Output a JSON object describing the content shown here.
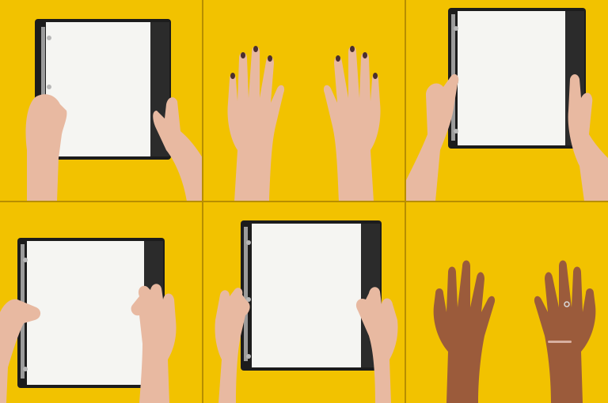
{
  "panels": [
    {
      "id": "p1",
      "content": "binder",
      "hands": "light"
    },
    {
      "id": "p2",
      "content": "hands-only",
      "hands": "light"
    },
    {
      "id": "p3",
      "content": "binder",
      "hands": "light"
    },
    {
      "id": "p4",
      "content": "binder",
      "hands": "light"
    },
    {
      "id": "p5",
      "content": "binder",
      "hands": "light"
    },
    {
      "id": "p6",
      "content": "hands-only",
      "hands": "dark"
    }
  ],
  "colors": {
    "background": "#f2c200",
    "background_shadow": "#e2b000",
    "binder": "#1c1c1c",
    "binder_edge": "#2f2f2f",
    "paper": "#f5f5f2",
    "ring": "#b7b7b7",
    "skin_light": "#e8b9a1",
    "skin_light_shadow": "#cf9a82",
    "skin_dark": "#9b5b3b",
    "skin_dark_shadow": "#7b4327",
    "nail": "#4a2e2e"
  }
}
